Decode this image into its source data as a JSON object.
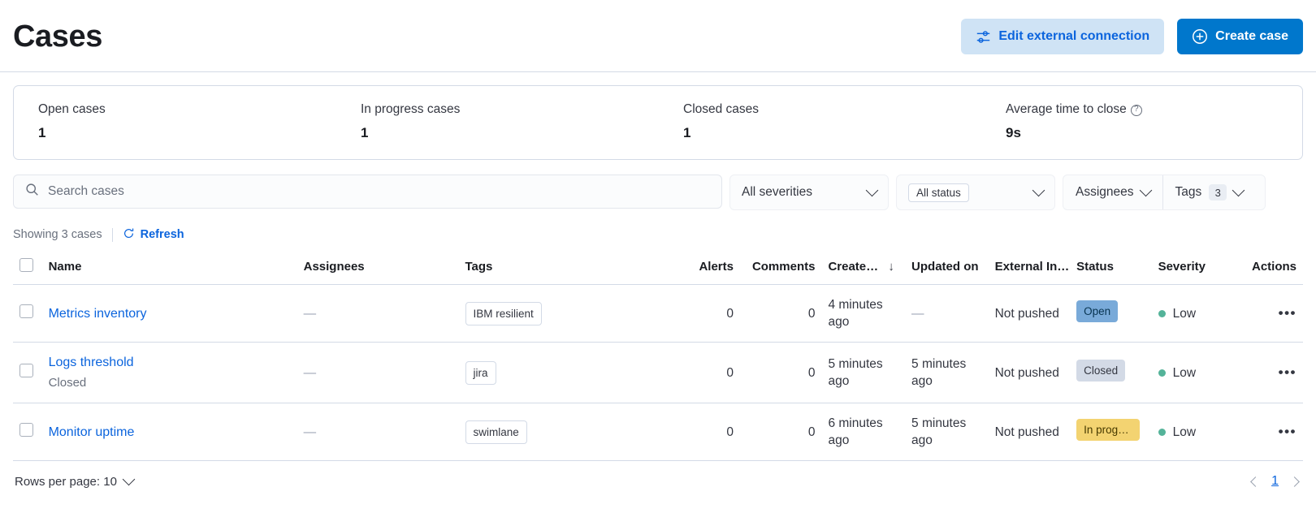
{
  "header": {
    "title": "Cases",
    "edit_connection_label": "Edit external connection",
    "create_case_label": "Create case",
    "edit_icon": "sliders-icon",
    "create_icon": "plus-circle-icon",
    "secondary_bg": "#cfe3f5",
    "primary_bg": "#0077cc"
  },
  "stats": [
    {
      "label": "Open cases",
      "value": "1"
    },
    {
      "label": "In progress cases",
      "value": "1"
    },
    {
      "label": "Closed cases",
      "value": "1"
    },
    {
      "label": "Average time to close",
      "value": "9s",
      "has_help_icon": true
    }
  ],
  "filters": {
    "search_placeholder": "Search cases",
    "search_value": "",
    "search_icon": "search-icon",
    "severity_label": "All severities",
    "status_label": "All status",
    "assignees_label": "Assignees",
    "tags_label": "Tags",
    "tags_count": "3"
  },
  "toolbar": {
    "showing_text": "Showing 3 cases",
    "refresh_label": "Refresh",
    "refresh_icon": "refresh-icon"
  },
  "table": {
    "columns": [
      "Name",
      "Assignees",
      "Tags",
      "Alerts",
      "Comments",
      "Create…",
      "Updated on",
      "External In…",
      "Status",
      "Severity",
      "Actions"
    ],
    "sorted_column": "Create…",
    "sort_direction": "↓",
    "rows": [
      {
        "name": "Metrics inventory",
        "subtitle": "",
        "assignees": "—",
        "tag": "IBM resilient",
        "alerts": "0",
        "comments": "0",
        "created": "4 minutes ago",
        "updated": "—",
        "external": "Not pushed",
        "status": "Open",
        "status_style": "badge-open",
        "severity": "Low",
        "severity_color": "#54b399",
        "actions_icon": "more-actions-icon"
      },
      {
        "name": "Logs threshold",
        "subtitle": "Closed",
        "assignees": "—",
        "tag": "jira",
        "alerts": "0",
        "comments": "0",
        "created": "5 minutes ago",
        "updated": "5 minutes ago",
        "external": "Not pushed",
        "status": "Closed",
        "status_style": "badge-closed",
        "severity": "Low",
        "severity_color": "#54b399",
        "actions_icon": "more-actions-icon"
      },
      {
        "name": "Monitor uptime",
        "subtitle": "",
        "assignees": "—",
        "tag": "swimlane",
        "alerts": "0",
        "comments": "0",
        "created": "6 minutes ago",
        "updated": "5 minutes ago",
        "external": "Not pushed",
        "status": "In progr…",
        "status_style": "badge-inprogress",
        "severity": "Low",
        "severity_color": "#54b399",
        "actions_icon": "more-actions-icon"
      }
    ]
  },
  "footer": {
    "rows_per_page_label": "Rows per page: 10",
    "current_page": "1"
  }
}
